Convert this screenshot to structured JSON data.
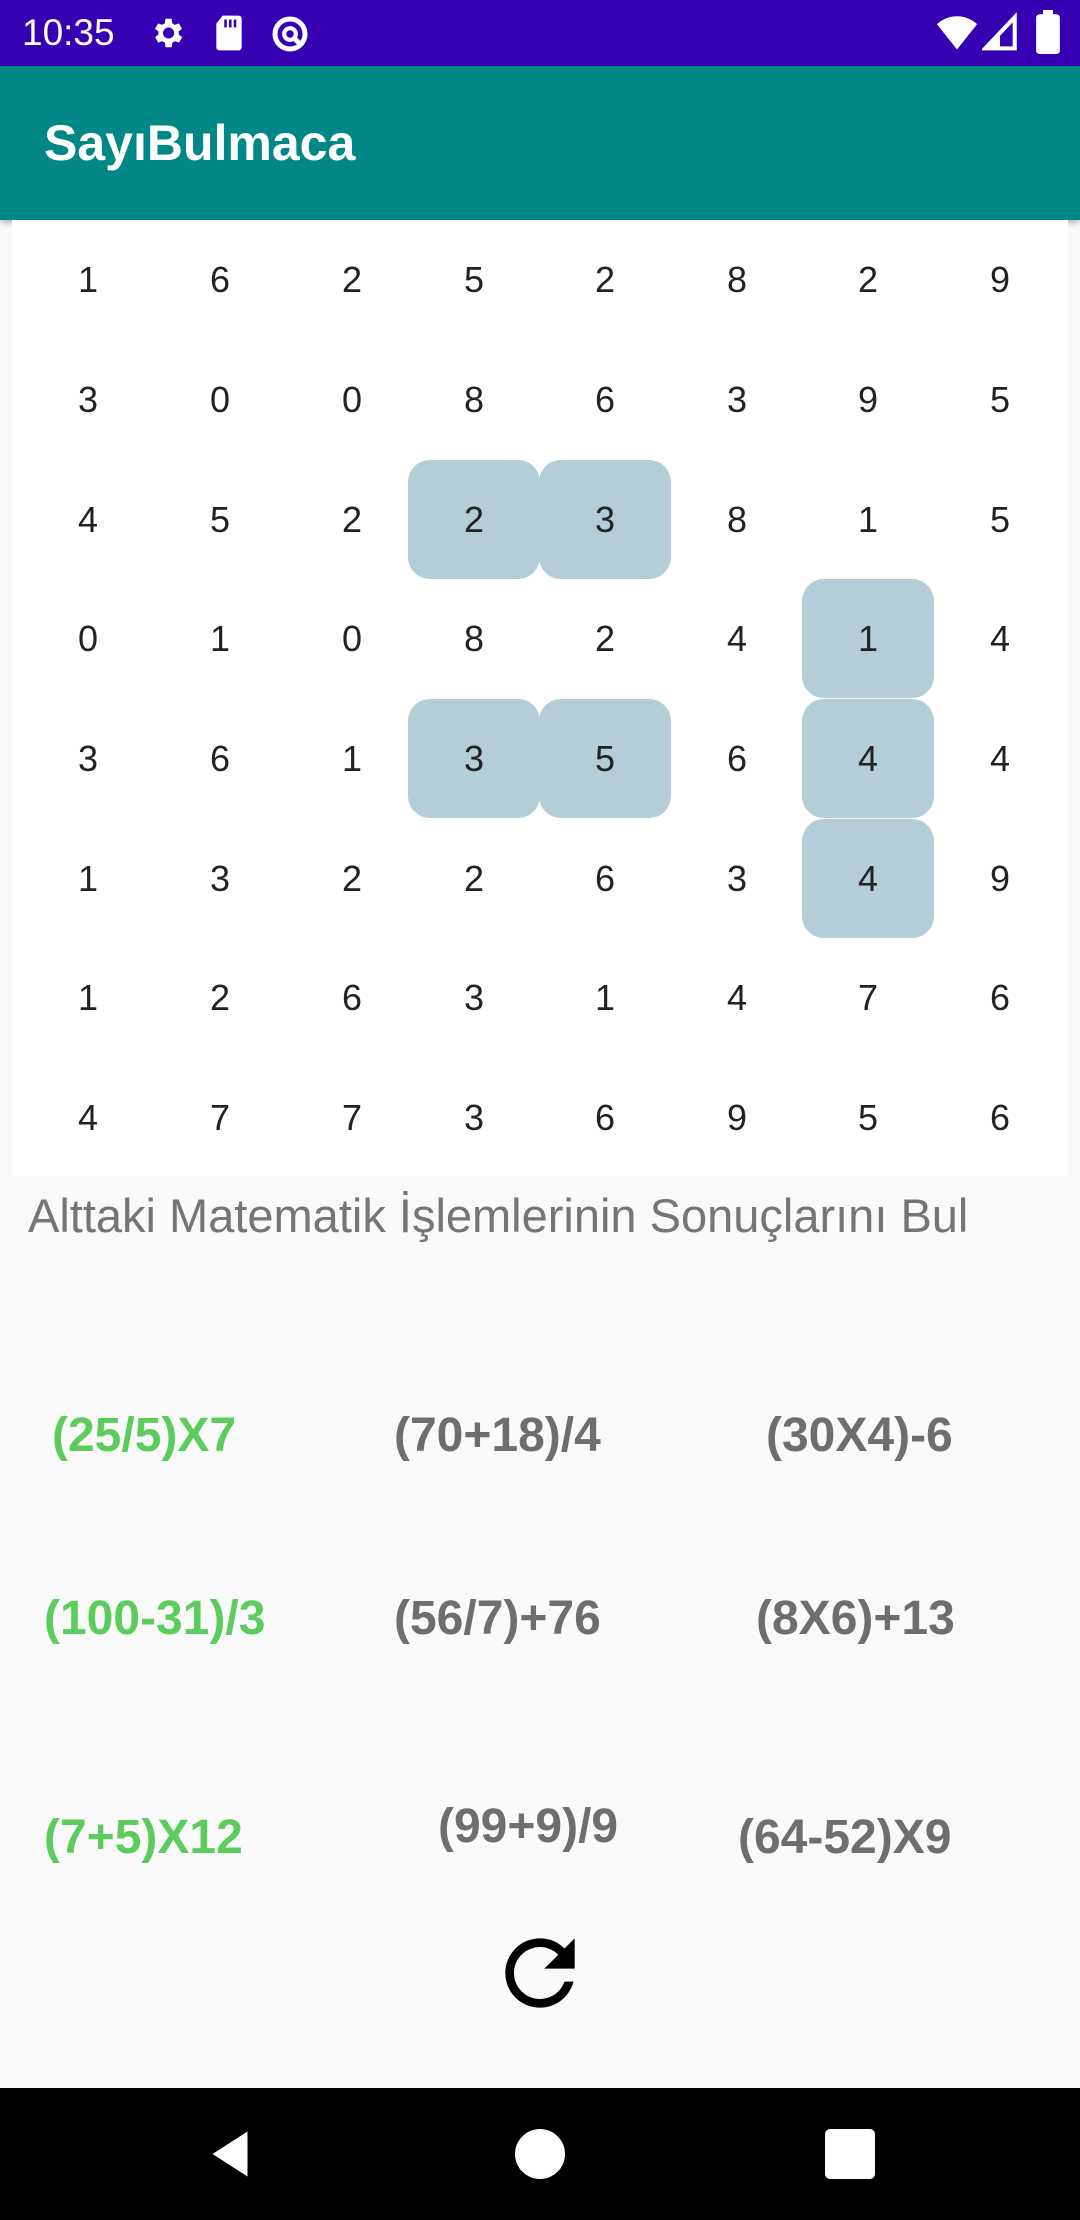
{
  "status_bar": {
    "time": "10:35",
    "left_icons": [
      "gear-icon",
      "sd-card-icon",
      "data-saver-icon"
    ],
    "right_icons": [
      "wifi-icon",
      "signal-icon",
      "battery-icon"
    ]
  },
  "app_bar": {
    "title": "SayıBulmaca"
  },
  "grid": {
    "rows": [
      [
        "1",
        "6",
        "2",
        "5",
        "2",
        "8",
        "2",
        "9"
      ],
      [
        "3",
        "0",
        "0",
        "8",
        "6",
        "3",
        "9",
        "5"
      ],
      [
        "4",
        "5",
        "2",
        "2",
        "3",
        "8",
        "1",
        "5"
      ],
      [
        "0",
        "1",
        "0",
        "8",
        "2",
        "4",
        "1",
        "4"
      ],
      [
        "3",
        "6",
        "1",
        "3",
        "5",
        "6",
        "4",
        "4"
      ],
      [
        "1",
        "3",
        "2",
        "2",
        "6",
        "3",
        "4",
        "9"
      ],
      [
        "1",
        "2",
        "6",
        "3",
        "1",
        "4",
        "7",
        "6"
      ],
      [
        "4",
        "7",
        "7",
        "3",
        "6",
        "9",
        "5",
        "6"
      ]
    ],
    "highlighted": [
      "2-3",
      "2-4",
      "3-6",
      "4-3",
      "4-4",
      "4-6",
      "5-6"
    ],
    "highlight_color": "#b3ced6"
  },
  "instruction": "Alttaki Matematik İşlemlerinin Sonuçlarını Bul",
  "equations": [
    {
      "text": "(25/5)X7",
      "solved": true
    },
    {
      "text": "(70+18)/4",
      "solved": false
    },
    {
      "text": "(30X4)-6",
      "solved": false
    },
    {
      "text": "(100-31)/3",
      "solved": true
    },
    {
      "text": "(56/7)+76",
      "solved": false
    },
    {
      "text": "(8X6)+13",
      "solved": false
    },
    {
      "text": "(7+5)X12",
      "solved": true
    },
    {
      "text": "(99+9)/9",
      "solved": false
    },
    {
      "text": "(64-52)X9",
      "solved": false
    }
  ],
  "colors": {
    "status_bar": "#3700b3",
    "app_bar": "#018786",
    "solved": "#5ccd5c",
    "unsolved": "#6e6e6e"
  },
  "refresh_icon": "refresh-icon",
  "nav_bar": {
    "buttons": [
      "back-icon",
      "home-icon",
      "recents-icon"
    ]
  }
}
